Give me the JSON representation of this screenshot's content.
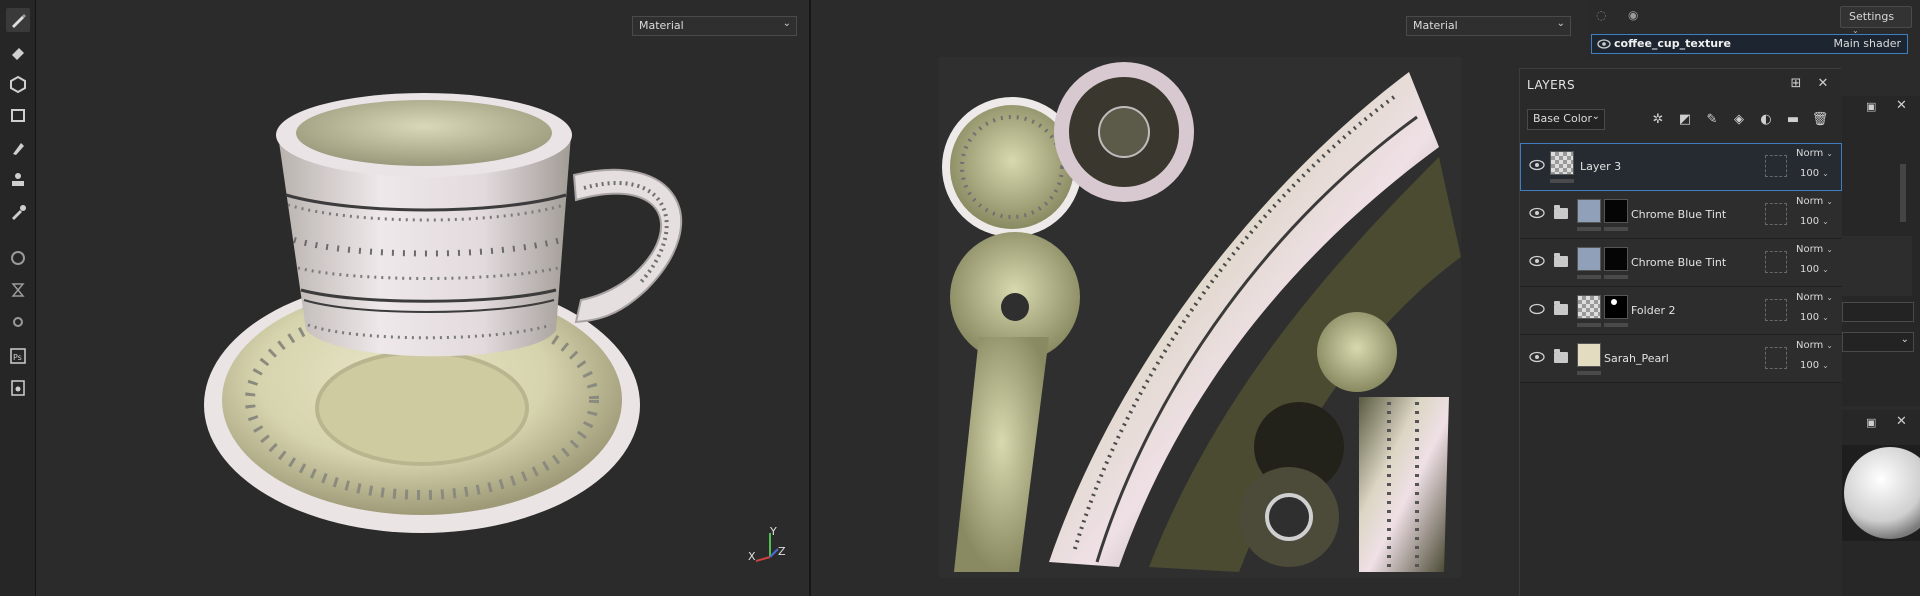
{
  "viewport3d": {
    "dropdown": "Material"
  },
  "viewport2d": {
    "dropdown": "Material"
  },
  "axis_gizmo": {
    "x": "X",
    "y": "Y",
    "z": "Z"
  },
  "texture_set": {
    "name": "coffee_cup_texture",
    "shader": "Main shader"
  },
  "settings_label": "Settings",
  "layers_panel": {
    "title": "LAYERS",
    "channel": "Base Color",
    "layers": [
      {
        "name": "Layer 3",
        "blend": "Norm",
        "opacity": "100"
      },
      {
        "name": "Chrome Blue Tint",
        "blend": "Norm",
        "opacity": "100"
      },
      {
        "name": "Chrome Blue Tint",
        "blend": "Norm",
        "opacity": "100"
      },
      {
        "name": "Folder 2",
        "blend": "Norm",
        "opacity": "100"
      },
      {
        "name": "Sarah_Pearl",
        "blend": "Norm",
        "opacity": "100"
      }
    ]
  },
  "colors": {
    "accent": "#3f7fbf",
    "panel": "#2a2a2a",
    "viewport": "#2b2b2b"
  }
}
